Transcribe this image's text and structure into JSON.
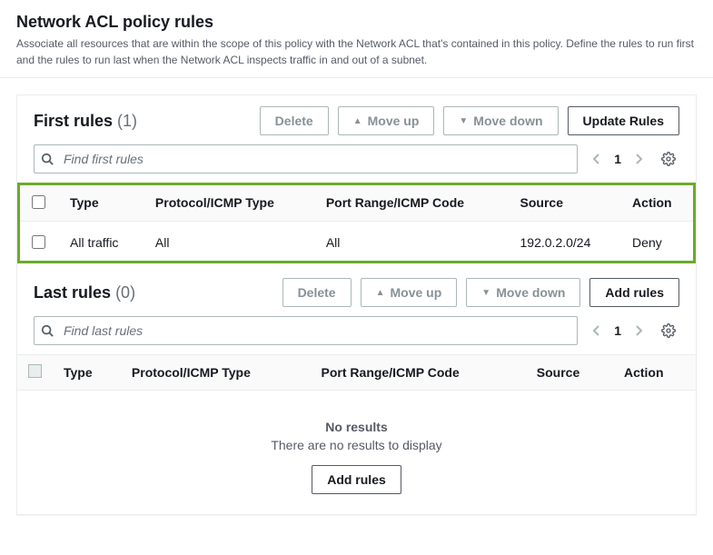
{
  "header": {
    "title": "Network ACL policy rules",
    "description": "Associate all resources that are within the scope of this policy with the Network ACL that's contained in this policy. Define the rules to run first and the rules to run last when the Network ACL inspects traffic in and out of a subnet."
  },
  "columns": {
    "type": "Type",
    "protocol": "Protocol/ICMP Type",
    "portrange": "Port Range/ICMP Code",
    "source": "Source",
    "action": "Action"
  },
  "buttons": {
    "delete": "Delete",
    "moveup": "Move up",
    "movedown": "Move down",
    "updateRules": "Update Rules",
    "addRules": "Add rules"
  },
  "first": {
    "title": "First rules",
    "count": "(1)",
    "searchPlaceholder": "Find first rules",
    "page": "1",
    "rows": [
      {
        "type": "All traffic",
        "protocol": "All",
        "portrange": "All",
        "source": "192.0.2.0/24",
        "action": "Deny"
      }
    ]
  },
  "last": {
    "title": "Last rules",
    "count": "(0)",
    "searchPlaceholder": "Find last rules",
    "page": "1",
    "emptyTitle": "No results",
    "emptyText": "There are no results to display"
  }
}
